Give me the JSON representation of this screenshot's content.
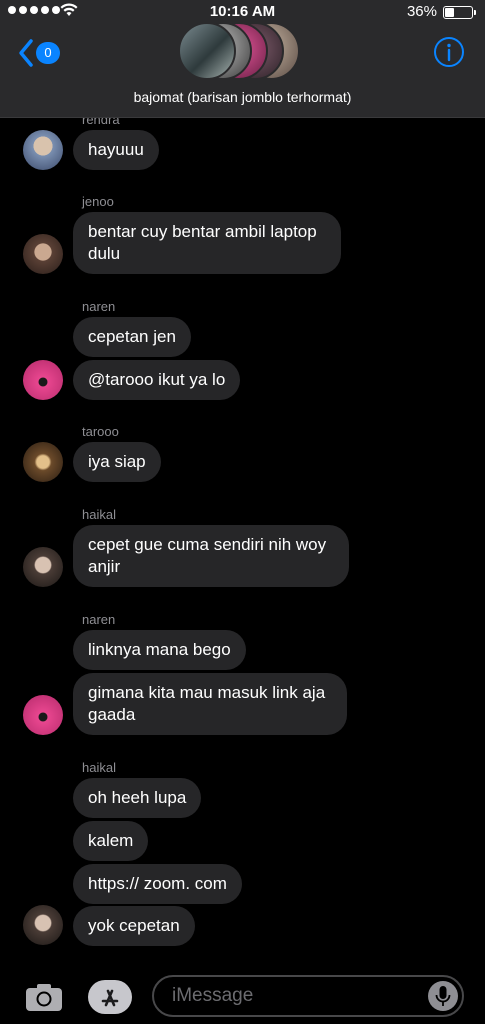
{
  "status_bar": {
    "time": "10:16 AM",
    "battery_percent": "36%",
    "battery_level": 0.36
  },
  "header": {
    "back_badge": "0",
    "group_name": "bajomat (barisan jomblo terhormat)"
  },
  "colors": {
    "accent": "#0a84ff",
    "bubble": "#262628",
    "header_bg": "#2a2a2c"
  },
  "messages": [
    {
      "sender": "rendra",
      "text": "hayuuu"
    },
    {
      "sender": "jenoo",
      "text": "bentar cuy bentar ambil laptop dulu"
    },
    {
      "sender": "naren",
      "text": "cepetan jen"
    },
    {
      "sender": "",
      "text": "@tarooo ikut ya lo"
    },
    {
      "sender": "tarooo",
      "text": "iya siap"
    },
    {
      "sender": "haikal",
      "text": "cepet gue cuma sendiri nih woy anjir"
    },
    {
      "sender": "naren",
      "text": "linknya mana bego"
    },
    {
      "sender": "",
      "text": "gimana kita mau masuk link aja gaada"
    },
    {
      "sender": "haikal",
      "text": "oh heeh lupa"
    },
    {
      "sender": "",
      "text": "kalem"
    },
    {
      "sender": "",
      "text": "https:// zoom. com"
    },
    {
      "sender": "",
      "text": "yok cepetan"
    }
  ],
  "input": {
    "placeholder": "iMessage"
  }
}
